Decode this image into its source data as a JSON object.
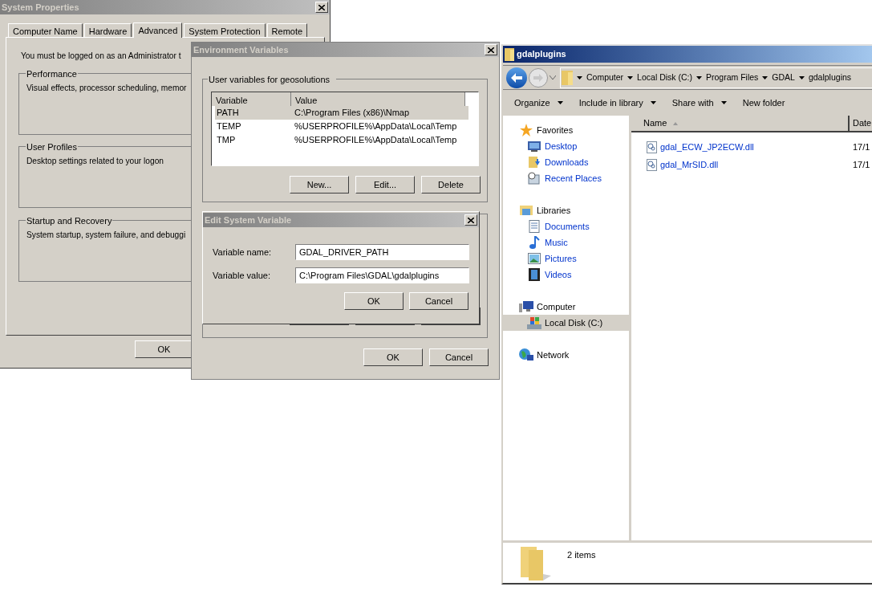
{
  "system_properties": {
    "title": "System Properties",
    "tabs": [
      {
        "label": "Computer Name",
        "selected": false
      },
      {
        "label": "Hardware",
        "selected": false
      },
      {
        "label": "Advanced",
        "selected": true
      },
      {
        "label": "System Protection",
        "selected": false
      },
      {
        "label": "Remote",
        "selected": false
      }
    ],
    "notice": "You must be logged on as an Administrator t",
    "groups": [
      {
        "title": "Performance",
        "description": "Visual effects, processor scheduling, memor"
      },
      {
        "title": "User Profiles",
        "description": "Desktop settings related to your logon"
      },
      {
        "title": "Startup and Recovery",
        "description": "System startup, system failure, and debuggi"
      }
    ],
    "ok_button": "OK"
  },
  "environment_variables": {
    "title": "Environment Variables",
    "user_group_title": "User variables for geosolutions",
    "columns": [
      "Variable",
      "Value"
    ],
    "rows": [
      {
        "variable": "PATH",
        "value": "C:\\Program Files (x86)\\Nmap",
        "selected": true
      },
      {
        "variable": "TEMP",
        "value": "%USERPROFILE%\\AppData\\Local\\Temp",
        "selected": false
      },
      {
        "variable": "TMP",
        "value": "%USERPROFILE%\\AppData\\Local\\Temp",
        "selected": false
      }
    ],
    "buttons": [
      "New...",
      "Edit...",
      "Delete"
    ],
    "dialog_buttons": [
      "OK",
      "Cancel"
    ]
  },
  "edit_system_variable": {
    "title": "Edit System Variable",
    "fields": [
      {
        "label": "Variable name:",
        "value": "GDAL_DRIVER_PATH"
      },
      {
        "label": "Variable value:",
        "value": "C:\\Program Files\\GDAL\\gdalplugins"
      }
    ],
    "buttons": [
      "OK",
      "Cancel"
    ]
  },
  "explorer": {
    "title": "gdalplugins",
    "breadcrumb": [
      "Computer",
      "Local Disk (C:)",
      "Program Files",
      "GDAL",
      "gdalplugins"
    ],
    "toolbar": [
      {
        "label": "Organize",
        "dropdown": true
      },
      {
        "label": "Include in library",
        "dropdown": true
      },
      {
        "label": "Share with",
        "dropdown": true
      },
      {
        "label": "New folder",
        "dropdown": false
      }
    ],
    "nav": [
      {
        "label": "Favorites",
        "selected": false,
        "children": [
          {
            "label": "Desktop",
            "selected": false
          },
          {
            "label": "Downloads",
            "selected": false
          },
          {
            "label": "Recent Places",
            "selected": false
          }
        ]
      },
      {
        "label": "Libraries",
        "selected": false,
        "children": [
          {
            "label": "Documents",
            "selected": false
          },
          {
            "label": "Music",
            "selected": false
          },
          {
            "label": "Pictures",
            "selected": false
          },
          {
            "label": "Videos",
            "selected": false
          }
        ]
      },
      {
        "label": "Computer",
        "selected": false,
        "children": [
          {
            "label": "Local Disk (C:)",
            "selected": true
          }
        ]
      },
      {
        "label": "Network",
        "selected": false
      }
    ],
    "columns": [
      "Name",
      "Date"
    ],
    "files": [
      {
        "name": "gdal_ECW_JP2ECW.dll",
        "date": "17/1"
      },
      {
        "name": "gdal_MrSID.dll",
        "date": "17/1"
      }
    ],
    "status": "2 items"
  }
}
